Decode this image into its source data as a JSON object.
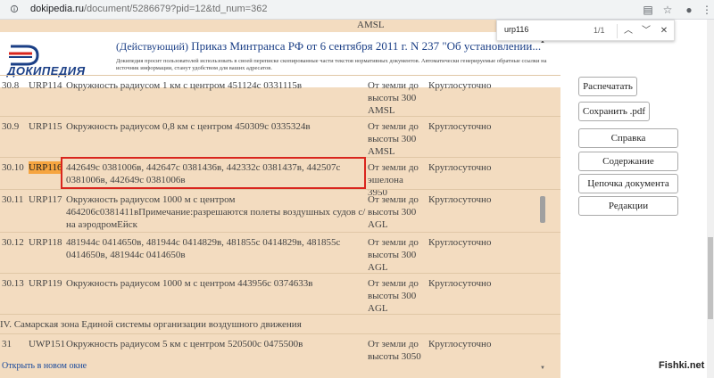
{
  "browser": {
    "url_host": "dokipedia.ru",
    "url_path": "/document/5286679?pid=12&td_num=362"
  },
  "find": {
    "query": "urp116",
    "count": "1/1"
  },
  "header": {
    "logo_text": "ДОКИПЕДИЯ",
    "status": "(Действующий)",
    "title": "Приказ Минтранса РФ от 6 сентября 2011 г. N 237 \"Об установлении...",
    "note": "Докипедия просит пользователей использовать в своей переписке скопированные части текстов нормативных документов. Автоматически генерируемые обратные ссылки на источник информации, станут удобством для ваших адресатов."
  },
  "table": {
    "top_fragment": "AMSL",
    "rows": [
      {
        "num": "30.8",
        "code": "URP114",
        "desc": "Окружность радиусом 1 км с центром 451124с 0331115в",
        "alt": "От земли до высоты 300 AMSL",
        "time": "Круглосуточно"
      },
      {
        "num": "30.9",
        "code": "URP115",
        "desc": "Окружность радиусом 0,8 км с центром 450309с 0335324в",
        "alt": "От земли до высоты 300 AMSL",
        "time": "Круглосуточно"
      },
      {
        "num": "30.10",
        "code": "URP116",
        "desc": "442649с 0381006в, 442647с 0381436в, 442332с 0381437в, 442507с 0381006в, 442649с 0381006в",
        "alt": "От земли до эшелона 3950",
        "time": "Круглосуточно"
      },
      {
        "num": "30.11",
        "code": "URP117",
        "desc": "Окружность радиусом 1000 м с центром 464206с0381411вПримечание:разрешаются полеты воздушных судов с/на аэродромЕйск",
        "alt": "От земли до высоты 300 AGL",
        "time": "Круглосуточно"
      },
      {
        "num": "30.12",
        "code": "URP118",
        "desc": "481944с 0414650в, 481944с 0414829в, 481855с 0414829в, 481855с 0414650в, 481944с 0414650в",
        "alt": "От земли до высоты 300 AGL",
        "time": "Круглосуточно"
      },
      {
        "num": "30.13",
        "code": "URP119",
        "desc": "Окружность радиусом 1000 м с центром 443956с 0374633в",
        "alt": "От земли до высоты 300 AGL",
        "time": "Круглосуточно"
      }
    ],
    "section_title": "IV. Самарская зона Единой системы организации воздушного движения",
    "last_row": {
      "num": "31",
      "code": "UWP151",
      "desc": "Окружность радиусом 5 км с центром 520500с 0475500в",
      "alt": "От земли до высоты 3050",
      "time": "Круглосуточно"
    },
    "open_link": "Открыть в новом окне"
  },
  "sidebar": {
    "print": "Распечатать",
    "save_pdf": "Сохранить .pdf",
    "help": "Справка",
    "contents": "Содержание",
    "chain": "Цепочка документа",
    "editions": "Редакции"
  },
  "watermark": "Fishki.net"
}
